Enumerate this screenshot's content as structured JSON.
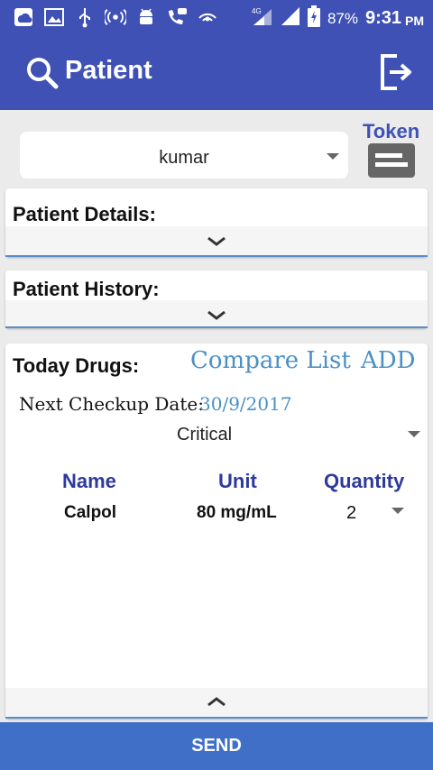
{
  "status_bar": {
    "battery": "87%",
    "time": "9:31",
    "ampm": "PM",
    "network": "4G"
  },
  "app_bar": {
    "title": "Patient"
  },
  "patient_selector": {
    "selected": "kumar"
  },
  "token": {
    "label": "Token"
  },
  "patient_details": {
    "title": "Patient Details:"
  },
  "patient_history": {
    "title": "Patient History:"
  },
  "today_drugs": {
    "title": "Today Drugs:",
    "compare_label": "Compare List",
    "add_label": "ADD",
    "next_checkup_label": "Next Checkup Date:",
    "next_checkup_value": "30/9/2017",
    "severity": "Critical",
    "columns": [
      "Name",
      "Unit",
      "Quantity"
    ],
    "rows": [
      {
        "name": "Calpol",
        "unit": "80 mg/mL",
        "quantity": "2"
      }
    ]
  },
  "send_label": "SEND",
  "colors": {
    "primary": "#3f51b5",
    "link": "#4a90c7",
    "header_text": "#2e3a9c",
    "send_button": "#3f6fc6"
  }
}
